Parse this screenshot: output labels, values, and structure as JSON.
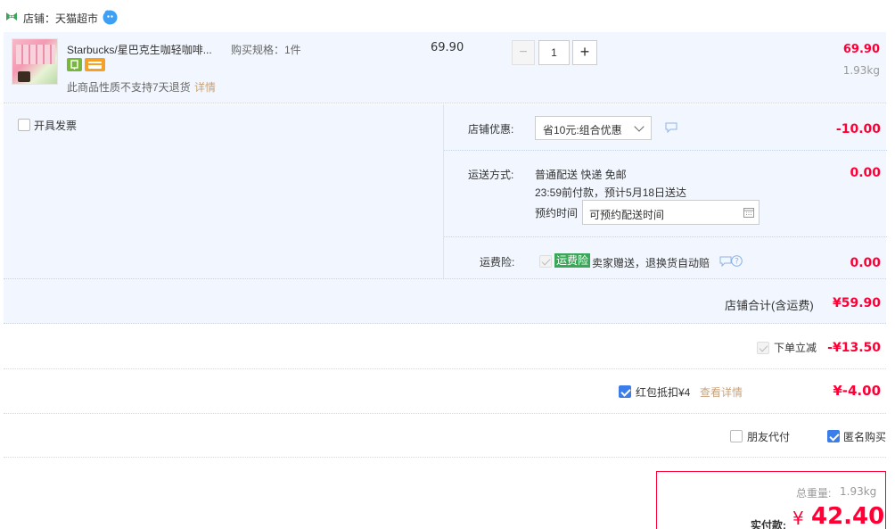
{
  "shop": {
    "name": "店铺：天猫超市"
  },
  "item": {
    "title": "Starbucks/星巴克生咖轻咖啡...",
    "spec": "购买规格：1件",
    "unit_price": "69.90",
    "quantity": "1",
    "total": "69.90",
    "weight": "1.93kg",
    "notice": "此商品性质不支持7天退货",
    "notice_link": "详情",
    "minus": "−",
    "plus": "+"
  },
  "invoice": {
    "label": "开具发票"
  },
  "discount": {
    "label": "店铺优惠:",
    "option": "省10元:组合优惠",
    "amount": "-10.00"
  },
  "delivery": {
    "label": "运送方式:",
    "method": "普通配送 快递 免邮",
    "eta": "23:59前付款，预计5月18日送达",
    "appointment_label": "预约时间",
    "appointment_placeholder": "可预约配送时间",
    "amount": "0.00"
  },
  "insurance": {
    "label": "运费险:",
    "badge": "运费险",
    "text": "卖家赠送，退换货自动赔",
    "amount": "0.00"
  },
  "shop_total": {
    "label": "店铺合计(含运费)",
    "amount": "¥59.90"
  },
  "instant": {
    "label": "下单立减",
    "amount": "-¥13.50"
  },
  "redpacket": {
    "label": "红包抵扣¥4",
    "link": "查看详情",
    "amount": "¥-4.00"
  },
  "options": {
    "friend_pay": "朋友代付",
    "anonymous": "匿名购买"
  },
  "summary": {
    "weight_label": "总重量:",
    "weight": "1.93kg",
    "pay_label": "实付款:",
    "currency": "¥",
    "amount": "42.40"
  },
  "colors": {
    "accent_red": "#ff0036",
    "row_bg": "#f2f7ff",
    "link": "#c6a27a",
    "check_blue": "#3b7de9",
    "badge_green": "#3aa657"
  }
}
